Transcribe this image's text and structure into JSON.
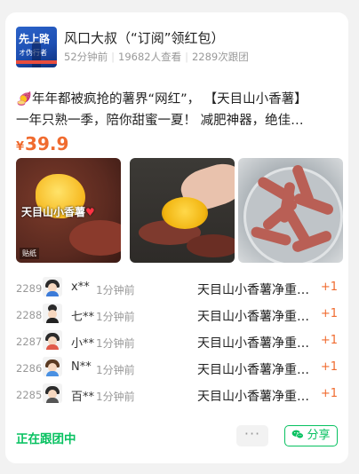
{
  "header": {
    "avatar_line1": "先上路",
    "avatar_line2": "オ伪行者",
    "title": "风口大叔（“订阅”领红包）",
    "time": "52分钟前",
    "views": "19682人查看",
    "joined": "2289次跟团"
  },
  "post": {
    "line1": "🍠年年都被疯抢的薯界“网红”， 【天目山小香薯】",
    "line2": "一年只熟一季，陪你甜蜜一夏！ 减肥神器，绝佳…",
    "price_currency": "¥",
    "price": "39.9"
  },
  "photos": {
    "p1_label": "天目山小香薯",
    "p1_heart": "♥",
    "p1_tag": "贴纸"
  },
  "orders": [
    {
      "no": "2289",
      "name": "x**",
      "time": "1分钟前",
      "product": "天目山小香薯净重…",
      "qty": "+1"
    },
    {
      "no": "2288",
      "name": "七**",
      "time": "1分钟前",
      "product": "天目山小香薯净重…",
      "qty": "+1"
    },
    {
      "no": "2287",
      "name": "小**",
      "time": "1分钟前",
      "product": "天目山小香薯净重…",
      "qty": "+1"
    },
    {
      "no": "2286",
      "name": "N**",
      "time": "1分钟前",
      "product": "天目山小香薯净重…",
      "qty": "+1"
    },
    {
      "no": "2285",
      "name": "百**",
      "time": "1分钟前",
      "product": "天目山小香薯净重…",
      "qty": "+1"
    }
  ],
  "footer": {
    "status": "正在跟团中",
    "more": "···",
    "share": "分享"
  },
  "colors": {
    "accent_orange": "#f06b2f",
    "wechat_green": "#07c160"
  }
}
